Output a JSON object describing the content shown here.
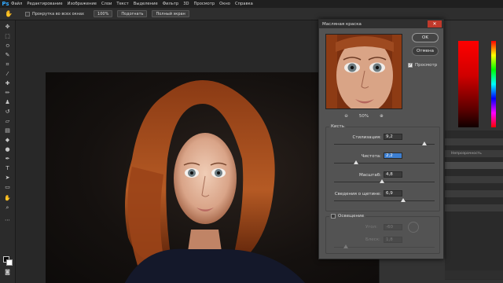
{
  "app": {
    "logo": "Ps"
  },
  "menu": [
    "Файл",
    "Редактирование",
    "Изображение",
    "Слои",
    "Текст",
    "Выделение",
    "Фильтр",
    "3D",
    "Просмотр",
    "Окно",
    "Справка"
  ],
  "options": {
    "scroll_all_windows": "Прокрутка во всех окнах",
    "zoom_value": "100%",
    "fit_button": "Подогнать",
    "fullscreen_button": "Полный экран"
  },
  "dialog": {
    "title": "Масляная краска",
    "close": "✕",
    "ok": "OK",
    "cancel": "Отмена",
    "preview_label": "Просмотр",
    "preview_checked": true,
    "zoom_out": "⊖",
    "zoom_in": "⊕",
    "zoom_level": "50%",
    "brush_group": "Кисть",
    "params": [
      {
        "label": "Стилизация:",
        "value": "9,2",
        "level": 0.9,
        "selected": false
      },
      {
        "label": "Чистота:",
        "value": "2,2",
        "level": 0.22,
        "selected": true
      },
      {
        "label": "Масштаб:",
        "value": "4,8",
        "level": 0.48,
        "selected": false
      },
      {
        "label": "Сведения о щетине:",
        "value": "6,9",
        "level": 0.69,
        "selected": false
      }
    ],
    "lighting_group": "Освещение",
    "lighting_checked": false,
    "angle_label": "Угол:",
    "angle_value": "-60",
    "shine_label": "Блеск:",
    "shine_value": "1,8"
  },
  "panel_labels": {
    "fill_text": "Непрозрачность"
  },
  "colors": {
    "accent": "#3d7fd1",
    "close_red": "#c0392b",
    "ps_blue": "#31a8ff"
  }
}
